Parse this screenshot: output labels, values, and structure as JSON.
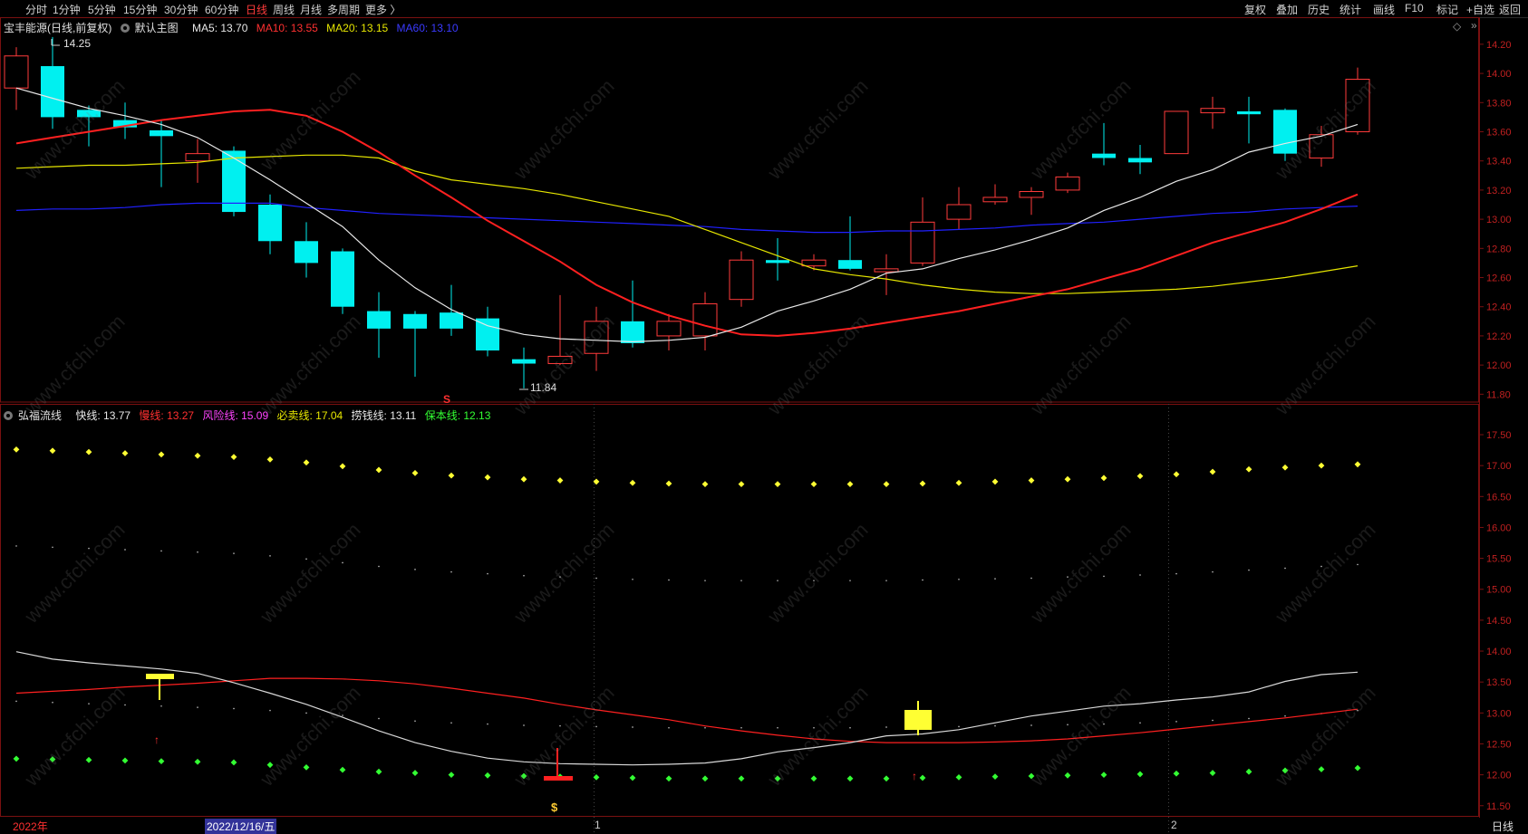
{
  "toolbar": {
    "left": [
      "分时",
      "1分钟",
      "5分钟",
      "15分钟",
      "30分钟",
      "60分钟",
      "日线",
      "周线",
      "月线",
      "多周期",
      "更多 〉"
    ],
    "active": "日线",
    "right": [
      "复权",
      "叠加",
      "历史",
      "统计",
      "画线",
      "F10",
      "标记",
      "+自选",
      "返回"
    ]
  },
  "main_info": {
    "stock": "宝丰能源(日线,前复权)",
    "template": "默认主图",
    "ma5": "MA5: 13.70",
    "ma10": "MA10: 13.55",
    "ma20": "MA20: 13.15",
    "ma60": "MA60: 13.10"
  },
  "sub_info": {
    "name": "弘福流线",
    "fast": "快线: 13.77",
    "slow": "慢线: 13.27",
    "risk": "风险线: 15.09",
    "sell": "必卖线: 17.04",
    "money": "捞钱线: 13.11",
    "base": "保本线: 12.13"
  },
  "annotations": {
    "high": "14.25",
    "low": "11.84",
    "s_mark": "S",
    "money_mark": "$"
  },
  "axes": {
    "main_ticks": [
      "14.20",
      "14.00",
      "13.80",
      "13.60",
      "13.40",
      "13.20",
      "13.00",
      "12.80",
      "12.60",
      "12.40",
      "12.20",
      "12.00",
      "11.80"
    ],
    "sub_ticks": [
      "17.50",
      "17.00",
      "16.50",
      "16.00",
      "15.50",
      "15.00",
      "14.50",
      "14.00",
      "13.50",
      "13.00",
      "12.50",
      "12.00",
      "11.50"
    ]
  },
  "bottom": {
    "year": "2022年",
    "date": "2022/12/16/五",
    "m1": "1",
    "m2": "2",
    "period": "日线"
  },
  "watermark": "www.cfchi.com",
  "colors": {
    "up": "#ff3b3b",
    "down": "#00f0f0",
    "ma5": "#e8e8e8",
    "ma10": "#ff2020",
    "ma20": "#e6e600",
    "ma60": "#2020ff"
  },
  "chart_data": {
    "type": "candlestick",
    "candles": [
      {
        "o": 13.9,
        "h": 14.18,
        "l": 13.75,
        "c": 14.12
      },
      {
        "o": 14.05,
        "h": 14.25,
        "l": 13.62,
        "c": 13.7
      },
      {
        "o": 13.75,
        "h": 13.78,
        "l": 13.5,
        "c": 13.7
      },
      {
        "o": 13.68,
        "h": 13.8,
        "l": 13.55,
        "c": 13.63
      },
      {
        "o": 13.61,
        "h": 13.68,
        "l": 13.22,
        "c": 13.57
      },
      {
        "o": 13.4,
        "h": 13.55,
        "l": 13.25,
        "c": 13.45
      },
      {
        "o": 13.47,
        "h": 13.5,
        "l": 13.02,
        "c": 13.05
      },
      {
        "o": 13.1,
        "h": 13.17,
        "l": 12.76,
        "c": 12.85
      },
      {
        "o": 12.85,
        "h": 12.98,
        "l": 12.6,
        "c": 12.7
      },
      {
        "o": 12.78,
        "h": 12.8,
        "l": 12.35,
        "c": 12.4
      },
      {
        "o": 12.37,
        "h": 12.5,
        "l": 12.05,
        "c": 12.25
      },
      {
        "o": 12.35,
        "h": 12.37,
        "l": 11.92,
        "c": 12.25
      },
      {
        "o": 12.36,
        "h": 12.55,
        "l": 12.2,
        "c": 12.25
      },
      {
        "o": 12.32,
        "h": 12.4,
        "l": 12.06,
        "c": 12.1
      },
      {
        "o": 12.04,
        "h": 12.12,
        "l": 11.84,
        "c": 12.01
      },
      {
        "o": 12.01,
        "h": 12.48,
        "l": 12.0,
        "c": 12.06
      },
      {
        "o": 12.08,
        "h": 12.4,
        "l": 11.96,
        "c": 12.3
      },
      {
        "o": 12.3,
        "h": 12.58,
        "l": 12.12,
        "c": 12.15
      },
      {
        "o": 12.2,
        "h": 12.35,
        "l": 12.1,
        "c": 12.3
      },
      {
        "o": 12.2,
        "h": 12.5,
        "l": 12.1,
        "c": 12.42
      },
      {
        "o": 12.45,
        "h": 12.78,
        "l": 12.4,
        "c": 12.72
      },
      {
        "o": 12.72,
        "h": 12.87,
        "l": 12.58,
        "c": 12.7
      },
      {
        "o": 12.68,
        "h": 12.76,
        "l": 12.65,
        "c": 12.72
      },
      {
        "o": 12.72,
        "h": 13.02,
        "l": 12.65,
        "c": 12.66
      },
      {
        "o": 12.64,
        "h": 12.76,
        "l": 12.48,
        "c": 12.66
      },
      {
        "o": 12.7,
        "h": 13.15,
        "l": 12.68,
        "c": 12.98
      },
      {
        "o": 13.0,
        "h": 13.22,
        "l": 12.93,
        "c": 13.1
      },
      {
        "o": 13.12,
        "h": 13.24,
        "l": 13.1,
        "c": 13.15
      },
      {
        "o": 13.15,
        "h": 13.22,
        "l": 13.03,
        "c": 13.19
      },
      {
        "o": 13.2,
        "h": 13.32,
        "l": 13.18,
        "c": 13.29
      },
      {
        "o": 13.45,
        "h": 13.66,
        "l": 13.37,
        "c": 13.42
      },
      {
        "o": 13.42,
        "h": 13.51,
        "l": 13.31,
        "c": 13.39
      },
      {
        "o": 13.45,
        "h": 13.74,
        "l": 13.45,
        "c": 13.74
      },
      {
        "o": 13.73,
        "h": 13.84,
        "l": 13.62,
        "c": 13.76
      },
      {
        "o": 13.74,
        "h": 13.84,
        "l": 13.52,
        "c": 13.72
      },
      {
        "o": 13.75,
        "h": 13.76,
        "l": 13.4,
        "c": 13.45
      },
      {
        "o": 13.42,
        "h": 13.64,
        "l": 13.36,
        "c": 13.58
      },
      {
        "o": 13.6,
        "h": 14.04,
        "l": 13.58,
        "c": 13.96
      }
    ],
    "ma5": [
      13.9,
      13.83,
      13.76,
      13.71,
      13.65,
      13.56,
      13.42,
      13.27,
      13.11,
      12.95,
      12.72,
      12.53,
      12.38,
      12.27,
      12.21,
      12.18,
      12.17,
      12.16,
      12.17,
      12.19,
      12.26,
      12.37,
      12.44,
      12.52,
      12.63,
      12.66,
      12.73,
      12.79,
      12.86,
      12.94,
      13.06,
      13.15,
      13.26,
      13.34,
      13.46,
      13.52,
      13.57,
      13.65,
      13.7
    ],
    "ma10": [
      13.52,
      13.56,
      13.6,
      13.64,
      13.68,
      13.71,
      13.74,
      13.75,
      13.71,
      13.6,
      13.46,
      13.3,
      13.15,
      12.99,
      12.85,
      12.71,
      12.55,
      12.43,
      12.34,
      12.27,
      12.21,
      12.2,
      12.22,
      12.25,
      12.29,
      12.33,
      12.37,
      12.42,
      12.47,
      12.52,
      12.59,
      12.66,
      12.75,
      12.84,
      12.91,
      12.98,
      13.07,
      13.17,
      13.3,
      13.38,
      13.44,
      13.5,
      13.55
    ],
    "ma20": [
      13.35,
      13.36,
      13.37,
      13.37,
      13.38,
      13.39,
      13.42,
      13.43,
      13.44,
      13.44,
      13.42,
      13.33,
      13.27,
      13.24,
      13.21,
      13.17,
      13.12,
      13.07,
      13.02,
      12.93,
      12.84,
      12.75,
      12.66,
      12.62,
      12.59,
      12.55,
      12.52,
      12.5,
      12.49,
      12.49,
      12.5,
      12.51,
      12.52,
      12.54,
      12.57,
      12.6,
      12.64,
      12.68,
      12.75,
      12.86,
      12.93,
      12.99,
      13.05,
      13.15
    ],
    "ma60": [
      13.06,
      13.07,
      13.07,
      13.08,
      13.1,
      13.11,
      13.11,
      13.11,
      13.08,
      13.06,
      13.04,
      13.03,
      13.02,
      13.01,
      13.0,
      12.99,
      12.98,
      12.97,
      12.96,
      12.95,
      12.93,
      12.92,
      12.91,
      12.91,
      12.92,
      12.92,
      12.93,
      12.94,
      12.96,
      12.97,
      12.98,
      13.0,
      13.02,
      13.04,
      13.05,
      13.07,
      13.08,
      13.09,
      13.1
    ],
    "sell_line": [
      17.26,
      17.24,
      17.22,
      17.2,
      17.18,
      17.16,
      17.14,
      17.1,
      17.05,
      16.99,
      16.93,
      16.88,
      16.84,
      16.81,
      16.78,
      16.76,
      16.74,
      16.72,
      16.71,
      16.7,
      16.7,
      16.7,
      16.7,
      16.7,
      16.7,
      16.71,
      16.72,
      16.74,
      16.76,
      16.78,
      16.8,
      16.83,
      16.86,
      16.9,
      16.94,
      16.97,
      17.0,
      17.02,
      17.04
    ],
    "risk_line": [
      15.7,
      15.68,
      15.66,
      15.64,
      15.62,
      15.6,
      15.58,
      15.54,
      15.49,
      15.43,
      15.37,
      15.32,
      15.28,
      15.25,
      15.22,
      15.2,
      15.18,
      15.16,
      15.15,
      15.14,
      15.14,
      15.14,
      15.14,
      15.14,
      15.14,
      15.15,
      15.16,
      15.17,
      15.18,
      15.2,
      15.21,
      15.23,
      15.25,
      15.28,
      15.31,
      15.34,
      15.37,
      15.4,
      15.43
    ],
    "money_line": [
      13.19,
      13.17,
      13.15,
      13.13,
      13.11,
      13.09,
      13.07,
      13.04,
      13.0,
      12.96,
      12.91,
      12.87,
      12.84,
      12.82,
      12.8,
      12.79,
      12.78,
      12.77,
      12.76,
      12.76,
      12.76,
      12.76,
      12.76,
      12.76,
      12.77,
      12.77,
      12.78,
      12.79,
      12.8,
      12.81,
      12.82,
      12.84,
      12.86,
      12.88,
      12.91,
      12.95,
      12.99,
      13.04,
      13.11
    ],
    "base_line": [
      12.26,
      12.25,
      12.24,
      12.23,
      12.22,
      12.21,
      12.2,
      12.16,
      12.12,
      12.08,
      12.05,
      12.03,
      12.0,
      11.99,
      11.98,
      11.97,
      11.96,
      11.95,
      11.94,
      11.94,
      11.94,
      11.94,
      11.94,
      11.94,
      11.94,
      11.95,
      11.96,
      11.97,
      11.98,
      11.99,
      12.0,
      12.01,
      12.02,
      12.03,
      12.05,
      12.07,
      12.09,
      12.11,
      12.13
    ],
    "fast_line": [
      13.99,
      13.87,
      13.81,
      13.76,
      13.71,
      13.64,
      13.49,
      13.32,
      13.14,
      12.93,
      12.71,
      12.52,
      12.38,
      12.27,
      12.21,
      12.18,
      12.17,
      12.16,
      12.17,
      12.19,
      12.26,
      12.37,
      12.44,
      12.52,
      12.63,
      12.66,
      12.73,
      12.84,
      12.95,
      13.03,
      13.11,
      13.15,
      13.21,
      13.26,
      13.34,
      13.51,
      13.62,
      13.66,
      13.6,
      13.62,
      13.77
    ],
    "slow_line": [
      13.32,
      13.35,
      13.38,
      13.42,
      13.45,
      13.48,
      13.52,
      13.56,
      13.56,
      13.55,
      13.52,
      13.47,
      13.4,
      13.32,
      13.24,
      13.14,
      13.05,
      12.97,
      12.89,
      12.79,
      12.71,
      12.64,
      12.58,
      12.54,
      12.52,
      12.52,
      12.52,
      12.53,
      12.55,
      12.58,
      12.63,
      12.68,
      12.74,
      12.8,
      12.86,
      12.92,
      12.99,
      13.06,
      13.13,
      13.2,
      13.27
    ],
    "ylim_main": [
      11.74,
      14.28
    ],
    "ylim_sub": [
      11.35,
      17.72
    ]
  }
}
